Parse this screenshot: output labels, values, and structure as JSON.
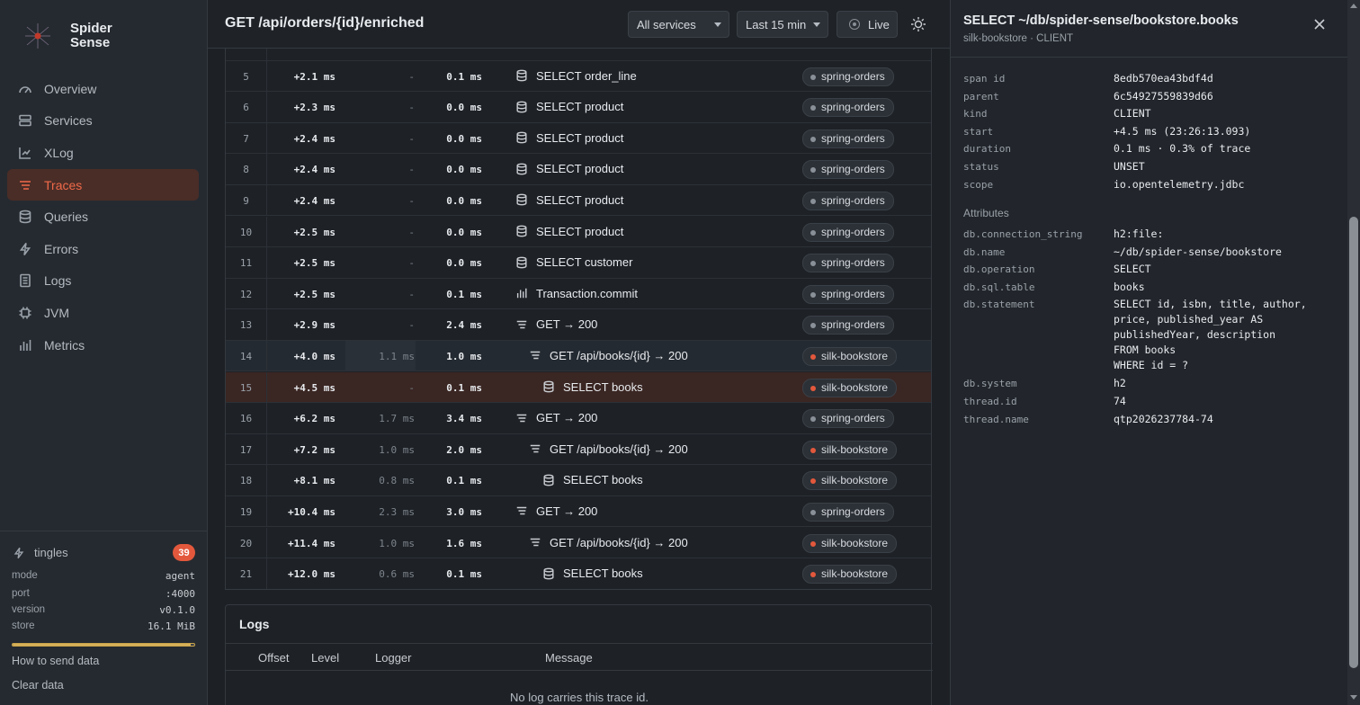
{
  "brand": {
    "name": "Spider Sense"
  },
  "nav": [
    {
      "label": "Overview",
      "icon": "gauge-icon"
    },
    {
      "label": "Services",
      "icon": "server-icon"
    },
    {
      "label": "XLog",
      "icon": "scatter-icon"
    },
    {
      "label": "Traces",
      "icon": "traces-icon",
      "active": true
    },
    {
      "label": "Queries",
      "icon": "database-icon"
    },
    {
      "label": "Errors",
      "icon": "bolt-icon"
    },
    {
      "label": "Logs",
      "icon": "document-icon"
    },
    {
      "label": "JVM",
      "icon": "chip-icon"
    },
    {
      "label": "Metrics",
      "icon": "bar-chart-icon"
    }
  ],
  "status": {
    "tingles_label": "tingles",
    "tingles_count": "39",
    "mode_label": "mode",
    "mode_value": "agent",
    "port_label": "port",
    "port_value": ":4000",
    "version_label": "version",
    "version_value": "v0.1.0",
    "store_label": "store",
    "store_value": "16.1 MiB",
    "store_fill_fraction": 0.98,
    "help_link": "How to send data",
    "clear_link": "Clear data"
  },
  "header": {
    "title": "GET /api/orders/{id}/enriched",
    "service_filter": "All services",
    "time_range": "Last 15 min",
    "live_label": "Live"
  },
  "spans": [
    {
      "idx": "5",
      "offset": "+2.1 ms",
      "self": "-",
      "duration": "0.1 ms",
      "icon": "database-icon",
      "name": "SELECT order_line",
      "depth": 0,
      "service": "spring-orders",
      "service_color": "#8a9098"
    },
    {
      "idx": "6",
      "offset": "+2.3 ms",
      "self": "-",
      "duration": "0.0 ms",
      "icon": "database-icon",
      "name": "SELECT product",
      "depth": 0,
      "service": "spring-orders",
      "service_color": "#8a9098"
    },
    {
      "idx": "7",
      "offset": "+2.4 ms",
      "self": "-",
      "duration": "0.0 ms",
      "icon": "database-icon",
      "name": "SELECT product",
      "depth": 0,
      "service": "spring-orders",
      "service_color": "#8a9098"
    },
    {
      "idx": "8",
      "offset": "+2.4 ms",
      "self": "-",
      "duration": "0.0 ms",
      "icon": "database-icon",
      "name": "SELECT product",
      "depth": 0,
      "service": "spring-orders",
      "service_color": "#8a9098"
    },
    {
      "idx": "9",
      "offset": "+2.4 ms",
      "self": "-",
      "duration": "0.0 ms",
      "icon": "database-icon",
      "name": "SELECT product",
      "depth": 0,
      "service": "spring-orders",
      "service_color": "#8a9098"
    },
    {
      "idx": "10",
      "offset": "+2.5 ms",
      "self": "-",
      "duration": "0.0 ms",
      "icon": "database-icon",
      "name": "SELECT product",
      "depth": 0,
      "service": "spring-orders",
      "service_color": "#8a9098"
    },
    {
      "idx": "11",
      "offset": "+2.5 ms",
      "self": "-",
      "duration": "0.0 ms",
      "icon": "database-icon",
      "name": "SELECT customer",
      "depth": 0,
      "service": "spring-orders",
      "service_color": "#8a9098"
    },
    {
      "idx": "12",
      "offset": "+2.5 ms",
      "self": "-",
      "duration": "0.1 ms",
      "icon": "bar-chart-icon",
      "name": "Transaction.commit",
      "depth": 0,
      "service": "spring-orders",
      "service_color": "#8a9098"
    },
    {
      "idx": "13",
      "offset": "+2.9 ms",
      "self": "-",
      "duration": "2.4 ms",
      "icon": "traces-icon",
      "name": "GET → 200",
      "depth": 0,
      "service": "spring-orders",
      "service_color": "#8a9098"
    },
    {
      "idx": "14",
      "offset": "+4.0 ms",
      "self": "1.1 ms",
      "duration": "1.0 ms",
      "icon": "traces-icon",
      "name": "GET /api/books/{id} → 200",
      "depth": 1,
      "service": "silk-bookstore",
      "service_color": "#e3583c",
      "state": "hover"
    },
    {
      "idx": "15",
      "offset": "+4.5 ms",
      "self": "-",
      "duration": "0.1 ms",
      "icon": "database-icon",
      "name": "SELECT books",
      "depth": 2,
      "service": "silk-bookstore",
      "service_color": "#e3583c",
      "state": "selected"
    },
    {
      "idx": "16",
      "offset": "+6.2 ms",
      "self": "1.7 ms",
      "duration": "3.4 ms",
      "icon": "traces-icon",
      "name": "GET → 200",
      "depth": 0,
      "service": "spring-orders",
      "service_color": "#8a9098"
    },
    {
      "idx": "17",
      "offset": "+7.2 ms",
      "self": "1.0 ms",
      "duration": "2.0 ms",
      "icon": "traces-icon",
      "name": "GET /api/books/{id} → 200",
      "depth": 1,
      "service": "silk-bookstore",
      "service_color": "#e3583c"
    },
    {
      "idx": "18",
      "offset": "+8.1 ms",
      "self": "0.8 ms",
      "duration": "0.1 ms",
      "icon": "database-icon",
      "name": "SELECT books",
      "depth": 2,
      "service": "silk-bookstore",
      "service_color": "#e3583c"
    },
    {
      "idx": "19",
      "offset": "+10.4 ms",
      "self": "2.3 ms",
      "duration": "3.0 ms",
      "icon": "traces-icon",
      "name": "GET → 200",
      "depth": 0,
      "service": "spring-orders",
      "service_color": "#8a9098"
    },
    {
      "idx": "20",
      "offset": "+11.4 ms",
      "self": "1.0 ms",
      "duration": "1.6 ms",
      "icon": "traces-icon",
      "name": "GET /api/books/{id} → 200",
      "depth": 1,
      "service": "silk-bookstore",
      "service_color": "#e3583c"
    },
    {
      "idx": "21",
      "offset": "+12.0 ms",
      "self": "0.6 ms",
      "duration": "0.1 ms",
      "icon": "database-icon",
      "name": "SELECT books",
      "depth": 2,
      "service": "silk-bookstore",
      "service_color": "#e3583c"
    }
  ],
  "logs": {
    "title": "Logs",
    "columns": [
      "Offset",
      "Level",
      "Logger",
      "Message"
    ],
    "empty_text": "No log carries this trace id."
  },
  "detail": {
    "title": "SELECT ~/db/spider-sense/bookstore.books",
    "subtitle": "silk-bookstore · CLIENT",
    "fields": [
      {
        "k": "span id",
        "v": "8edb570ea43bdf4d"
      },
      {
        "k": "parent",
        "v": "6c54927559839d66"
      },
      {
        "k": "kind",
        "v": "CLIENT"
      },
      {
        "k": "start",
        "v": "+4.5 ms (23:26:13.093)"
      },
      {
        "k": "duration",
        "v": "0.1 ms · 0.3% of trace"
      },
      {
        "k": "status",
        "v": "UNSET"
      },
      {
        "k": "scope",
        "v": "io.opentelemetry.jdbc"
      }
    ],
    "attributes_label": "Attributes",
    "attributes": [
      {
        "k": "db.connection_string",
        "v": "h2:file:"
      },
      {
        "k": "db.name",
        "v": "~/db/spider-sense/bookstore"
      },
      {
        "k": "db.operation",
        "v": "SELECT"
      },
      {
        "k": "db.sql.table",
        "v": "books"
      },
      {
        "k": "db.statement",
        "v": "SELECT id, isbn, title, author,\nprice, published_year AS\npublishedYear, description\nFROM books\nWHERE id = ?"
      },
      {
        "k": "db.system",
        "v": "h2"
      },
      {
        "k": "thread.id",
        "v": "74"
      },
      {
        "k": "thread.name",
        "v": "qtp2026237784-74"
      }
    ]
  }
}
